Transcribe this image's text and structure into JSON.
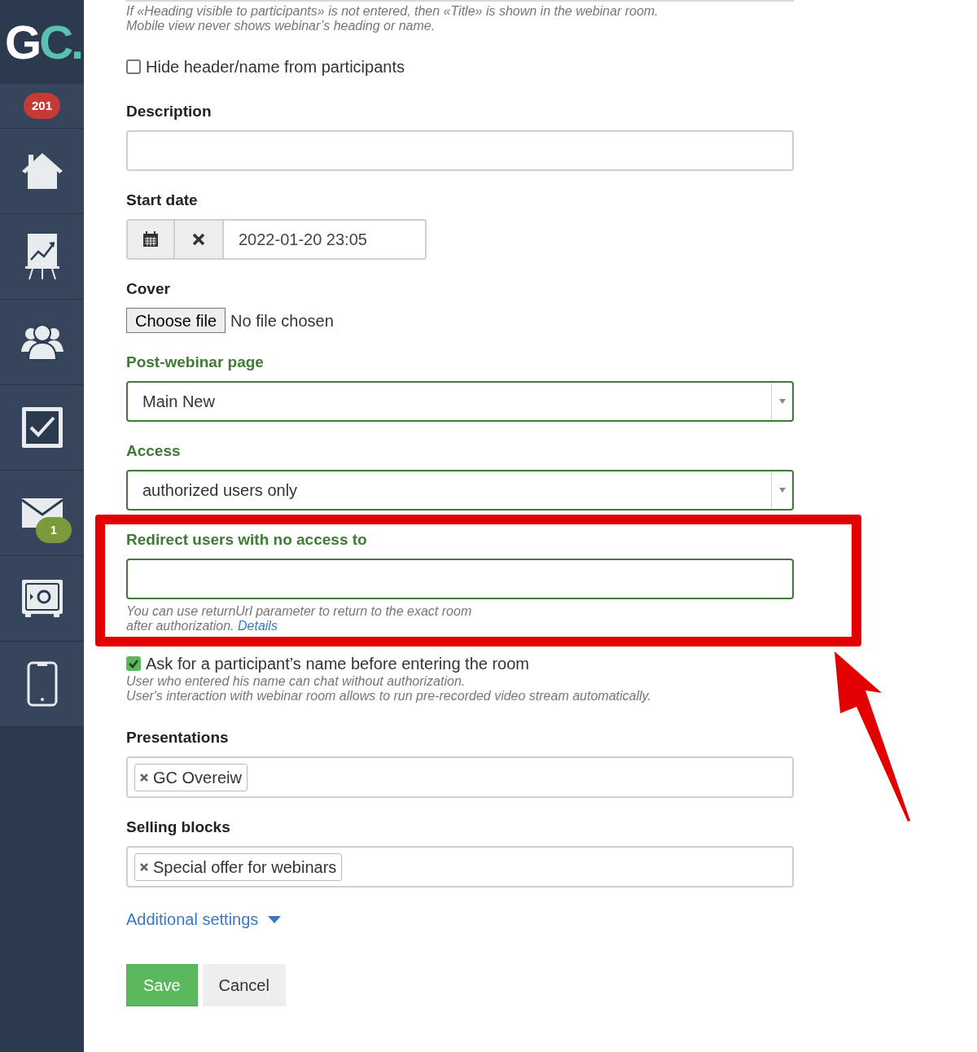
{
  "sidebar": {
    "logo": {
      "primary": "G",
      "accent": "C."
    },
    "items": [
      {
        "kind": "counter",
        "badge": "201",
        "color": "#c33b32"
      },
      {
        "kind": "home"
      },
      {
        "kind": "chart"
      },
      {
        "kind": "users"
      },
      {
        "kind": "tasks"
      },
      {
        "kind": "mail",
        "badge": "1",
        "color": "#7a9a3c"
      },
      {
        "kind": "safe"
      },
      {
        "kind": "phone"
      }
    ]
  },
  "form": {
    "fields": [
      {
        "kind": "note",
        "lines": [
          "If «Heading visible to participants» is not entered, then «Title» is shown in the webinar room.",
          "Mobile view never shows webinar’s heading or name."
        ]
      },
      {
        "kind": "checkbox",
        "label": "Hide header/name from participants",
        "checked": false
      },
      {
        "kind": "text",
        "label": "Description",
        "highlighted": false
      },
      {
        "kind": "date",
        "label": "Start date",
        "value": "2022-01-20 23:05"
      },
      {
        "kind": "file",
        "label": "Cover",
        "button": "Choose file",
        "status": "No file chosen"
      },
      {
        "kind": "select",
        "label": "Post-webinar page",
        "value": "Main New",
        "highlighted": true
      },
      {
        "kind": "select",
        "label": "Access",
        "value": "authorized users only",
        "highlighted": true
      },
      {
        "kind": "text",
        "label": "Redirect users with no access to",
        "highlighted": true,
        "help": [
          "You can use returnUrl parameter to return to the exact room",
          "after authorization."
        ],
        "help_link": "Details"
      },
      {
        "kind": "checkbox",
        "label": "Ask for a participant’s name before entering the room",
        "checked": true,
        "help": [
          "User who entered his name can chat without authorization.",
          "User's interaction with webinar room allows to run pre-recorded video stream automatically."
        ]
      },
      {
        "kind": "tags",
        "label": "Presentations",
        "tags": [
          "GC Overeiw"
        ],
        "highlighted": false
      },
      {
        "kind": "tags",
        "label": "Selling blocks",
        "tags": [
          "Special offer for webinars"
        ],
        "highlighted": false
      }
    ],
    "additional_settings": "Additional settings",
    "buttons": [
      {
        "kind": "primary",
        "label": "Save"
      },
      {
        "kind": "secondary",
        "label": "Cancel"
      }
    ]
  }
}
